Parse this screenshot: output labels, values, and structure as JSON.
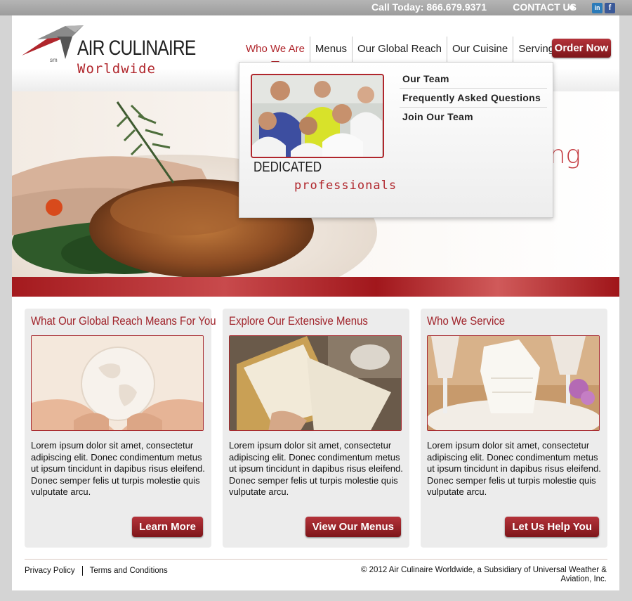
{
  "topbar": {
    "call": "Call Today: 866.679.9371",
    "contact": "CONTACT US",
    "linkedin_icon": "linkedin-icon",
    "facebook_icon": "facebook-icon"
  },
  "logo": {
    "brand": "AIR CULINAIRE",
    "sub": "Worldwide",
    "sm": "sm"
  },
  "nav": {
    "items": [
      "Who We Are",
      "Menus",
      "Our Global Reach",
      "Our Cuisine",
      "Serving You"
    ],
    "order_button": "Order Now"
  },
  "dropdown": {
    "dedicated": "DEDICATED",
    "professionals": "professionals",
    "links": [
      "Our Team",
      "Frequently Asked Questions",
      "Join Our Team"
    ]
  },
  "hero": {
    "tagline": "ing"
  },
  "cards": [
    {
      "title": "What Our Global Reach Means For You",
      "body": "Lorem ipsum dolor sit amet, consectetur adipiscing elit. Donec condimentum metus ut ipsum tincidunt in dapibus risus eleifend. Donec semper felis ut turpis molestie quis vulputate arcu.",
      "button": "Learn More"
    },
    {
      "title": "Explore Our Extensive Menus",
      "body": "Lorem ipsum dolor sit amet, consectetur adipiscing elit. Donec condimentum metus ut ipsum tincidunt in dapibus risus eleifend. Donec semper felis ut turpis molestie quis vulputate arcu.",
      "button": "View Our Menus"
    },
    {
      "title": "Who We Service",
      "body": "Lorem ipsum dolor sit amet, consectetur adipiscing elit. Donec condimentum metus ut ipsum tincidunt in dapibus risus eleifend. Donec semper felis ut turpis molestie quis vulputate arcu.",
      "button": "Let Us Help You"
    }
  ],
  "footer": {
    "privacy": "Privacy Policy",
    "terms": "Terms and Conditions",
    "copyright": "© 2012 Air Culinaire Worldwide, a Subsidiary of Universal Weather & Aviation, Inc."
  },
  "colors": {
    "accent": "#b0262c",
    "button_top": "#b4333a",
    "button_bottom": "#7d1519"
  }
}
